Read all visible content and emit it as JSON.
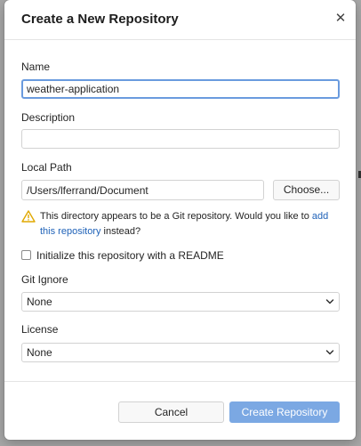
{
  "dialog": {
    "title": "Create a New Repository",
    "close_icon": "close-icon"
  },
  "form": {
    "name": {
      "label": "Name",
      "value": "weather-application"
    },
    "description": {
      "label": "Description",
      "value": ""
    },
    "local_path": {
      "label": "Local Path",
      "value": "/Users/lferrand/Document",
      "choose_label": "Choose..."
    },
    "warning": {
      "icon": "warning-triangle-icon",
      "text_before": "This directory appears to be a Git repository. Would you like to ",
      "link": "add this repository",
      "text_after": " instead?"
    },
    "readme": {
      "label": "Initialize this repository with a README",
      "checked": false
    },
    "git_ignore": {
      "label": "Git Ignore",
      "selected": "None"
    },
    "license": {
      "label": "License",
      "selected": "None"
    }
  },
  "footer": {
    "cancel_label": "Cancel",
    "create_label": "Create Repository"
  },
  "colors": {
    "accent": "#7ba8e3",
    "focus": "#6a9bde",
    "link": "#1f62b8",
    "warning": "#e0a800"
  }
}
